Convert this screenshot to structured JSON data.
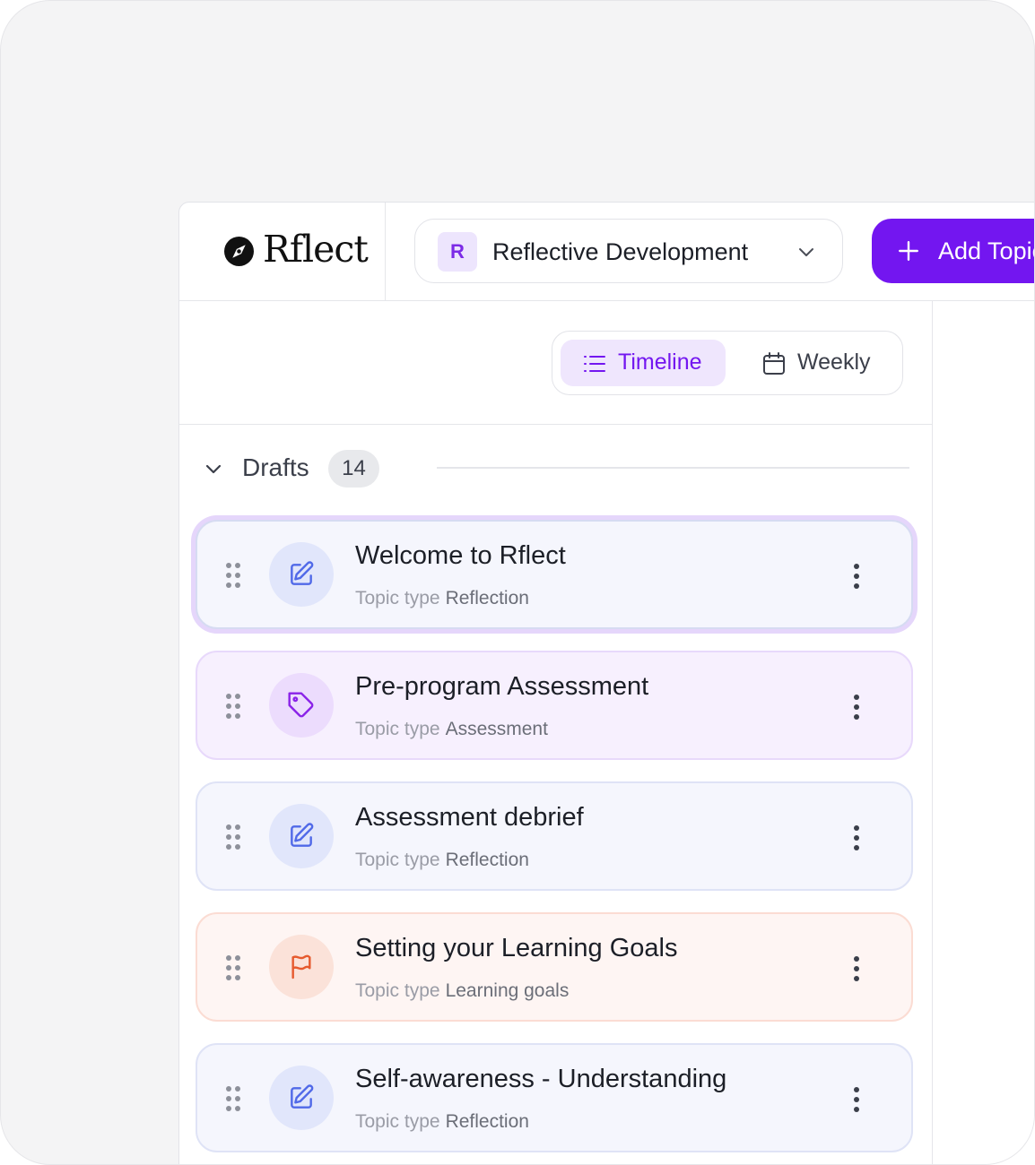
{
  "brand": {
    "name": "Rflect",
    "logo_icon": "compass-icon"
  },
  "project": {
    "avatar_letter": "R",
    "name": "Reflective Development",
    "chevron_icon": "chevron-down-icon"
  },
  "add_topic": {
    "label": "Add Topic",
    "icon": "plus-icon"
  },
  "views": [
    {
      "label": "Timeline",
      "icon": "list-icon",
      "active": true
    },
    {
      "label": "Weekly",
      "icon": "calendar-icon",
      "active": false
    }
  ],
  "drafts": {
    "title": "Drafts",
    "count": "14",
    "items": [
      {
        "title": "Welcome to Rflect",
        "meta_label": "Topic type",
        "type": "Reflection",
        "icon": "edit-icon",
        "theme": "blue",
        "selected": true
      },
      {
        "title": "Pre-program Assessment",
        "meta_label": "Topic type",
        "type": "Assessment",
        "icon": "tag-icon",
        "theme": "purple",
        "selected": false
      },
      {
        "title": "Assessment debrief",
        "meta_label": "Topic type",
        "type": "Reflection",
        "icon": "edit-icon",
        "theme": "blue",
        "selected": false
      },
      {
        "title": "Setting your Learning Goals",
        "meta_label": "Topic type",
        "type": "Learning goals",
        "icon": "flag-icon",
        "theme": "orange",
        "selected": false
      },
      {
        "title": "Self-awareness - Understanding",
        "meta_label": "Topic type",
        "type": "Reflection",
        "icon": "edit-icon",
        "theme": "blue",
        "selected": false
      }
    ]
  },
  "colors": {
    "accent": "#7316f0",
    "reflection_icon": "#5069e8",
    "assessment_icon": "#8a22e8",
    "learning_goals_icon": "#e65a2e"
  }
}
